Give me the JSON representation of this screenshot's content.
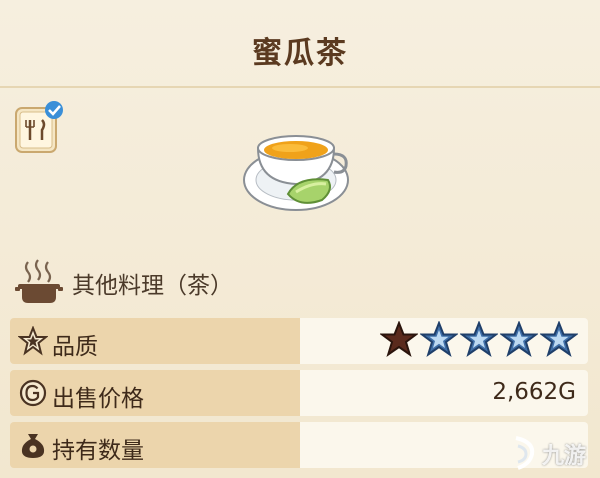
{
  "item": {
    "name": "蜜瓜茶",
    "category": "其他料理（茶）"
  },
  "stats": {
    "quality_label": "品质",
    "quality_rating": 1,
    "quality_max": 5,
    "price_label": "出售价格",
    "price_value": "2,662G",
    "owned_label": "持有数量",
    "owned_value": ""
  },
  "icons": {
    "recipe": "recipe-book-check-icon",
    "dish": "melon-tea-cup-icon",
    "category": "cooking-pot-icon",
    "quality": "star-outline-icon",
    "price": "gold-coin-icon",
    "owned": "money-bag-icon"
  },
  "colors": {
    "title": "#5b3a20",
    "label_band": "#ecd5ac",
    "star_filled": "#5a2a1c",
    "star_empty": "#3f6fa8"
  },
  "watermark": {
    "text": "九游"
  }
}
